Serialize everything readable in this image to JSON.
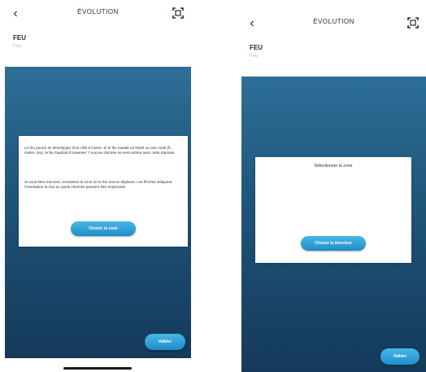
{
  "screens": [
    {
      "header": {
        "title": "ÉVOLUTION",
        "back_icon": "chevron-left-icon",
        "scan_icon": "qr-scan-icon"
      },
      "entity": {
        "name": "FEU",
        "subtitle": "Feu"
      },
      "modal": {
        "paragraph_1": "Le feu pourra se développer d'un côté à l'autre. Si le feu sautait un fossé ou une route (fi, rivière, feu), le feu faudrait-il traverser ? Aucune donnée ne sera entrée avec cette réponse.",
        "paragraph_2": "Si vous êtes d'accord, choisissez la zone où le feu doit se déplacer. Les flèches indiquent l'orientation du feu ou quels chemins peuvent être empruntés.",
        "button_label": "Choisir la zone"
      },
      "fab_label": "Valider"
    },
    {
      "header": {
        "title": "ÉVOLUTION",
        "back_icon": "chevron-left-icon",
        "scan_icon": "qr-scan-icon"
      },
      "entity": {
        "name": "FEU",
        "subtitle": "Feu"
      },
      "modal": {
        "title": "Sélectionner la zone",
        "button_label": "Choisir la direction"
      },
      "fab_label": "Valider"
    }
  ],
  "colors": {
    "panel_top": "#2e6f97",
    "panel_bottom": "#15395a",
    "accent": "#2aa3dc",
    "text_dark": "#1d2a3a"
  }
}
